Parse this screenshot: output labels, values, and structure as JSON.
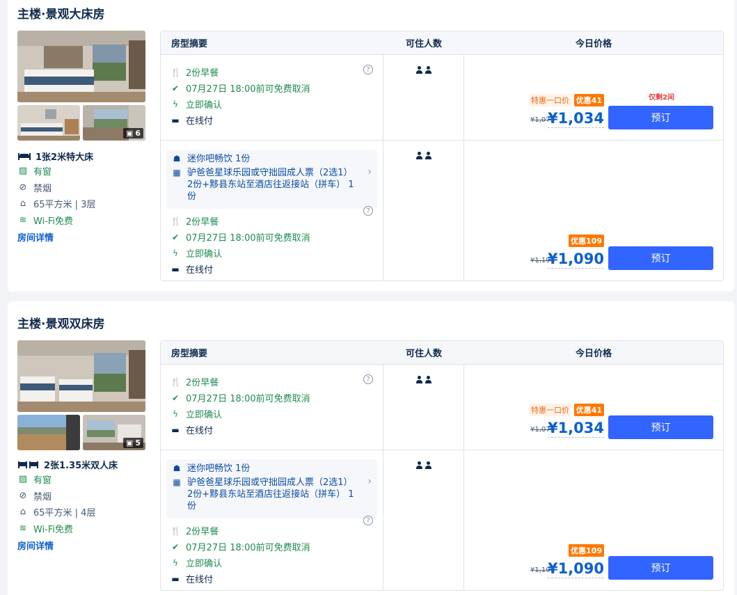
{
  "rooms": [
    {
      "title": "主楼·景观大床房",
      "photo_count": "6",
      "bed": "1张2米特大床",
      "bed_icon": "double-bed-icon",
      "facts": {
        "window": "有窗",
        "smoking": "禁烟",
        "area_floor": "65平方米 | 3层",
        "wifi": "Wi-Fi免费"
      },
      "detail_link": "房间详情",
      "header": {
        "summary": "房型摘要",
        "occupancy": "可住人数",
        "price": "今日价格"
      },
      "offers": [
        {
          "breakfast": "2份早餐",
          "cancel": "07月27日 18:00前可免费取消",
          "confirm": "立即确认",
          "payment": "在线付",
          "special_tag": "特惠一口价",
          "discount_tag": "优惠41",
          "left_note": "仅剩2间",
          "old_price": "¥1,075",
          "price": "¥1,034",
          "book": "预订"
        },
        {
          "perk_food": "迷你吧畅饮 1份",
          "perk_ticket": "驴爸爸星球乐园或守拙园成人票（2选1） 2份+黟县东站至酒店往返接站（拼车） 1份",
          "breakfast": "2份早餐",
          "cancel": "07月27日 18:00前可免费取消",
          "confirm": "立即确认",
          "payment": "在线付",
          "discount_tag": "优惠109",
          "old_price": "¥1,199",
          "price": "¥1,090",
          "book": "预订"
        }
      ]
    },
    {
      "title": "主楼·景观双床房",
      "photo_count": "5",
      "bed": "2张1.35米双人床",
      "bed_icon": "twin-bed-icon",
      "facts": {
        "window": "有窗",
        "smoking": "禁烟",
        "area_floor": "65平方米 | 4层",
        "wifi": "Wi-Fi免费"
      },
      "detail_link": "房间详情",
      "header": {
        "summary": "房型摘要",
        "occupancy": "可住人数",
        "price": "今日价格"
      },
      "offers": [
        {
          "breakfast": "2份早餐",
          "cancel": "07月27日 18:00前可免费取消",
          "confirm": "立即确认",
          "payment": "在线付",
          "special_tag": "特惠一口价",
          "discount_tag": "优惠41",
          "old_price": "¥1,075",
          "price": "¥1,034",
          "book": "预订"
        },
        {
          "perk_food": "迷你吧畅饮 1份",
          "perk_ticket": "驴爸爸星球乐园或守拙园成人票（2选1） 2份+黟县东站至酒店往返接站（拼车） 1份",
          "breakfast": "2份早餐",
          "cancel": "07月27日 18:00前可免费取消",
          "confirm": "立即确认",
          "payment": "在线付",
          "discount_tag": "优惠109",
          "old_price": "¥1,199",
          "price": "¥1,090",
          "book": "预订"
        }
      ]
    }
  ],
  "colors": {
    "accent": "#3264ff",
    "price": "#0b5fd0",
    "green": "#1f8b4f",
    "discount": "#ff7700",
    "warning": "#e63b3b"
  }
}
